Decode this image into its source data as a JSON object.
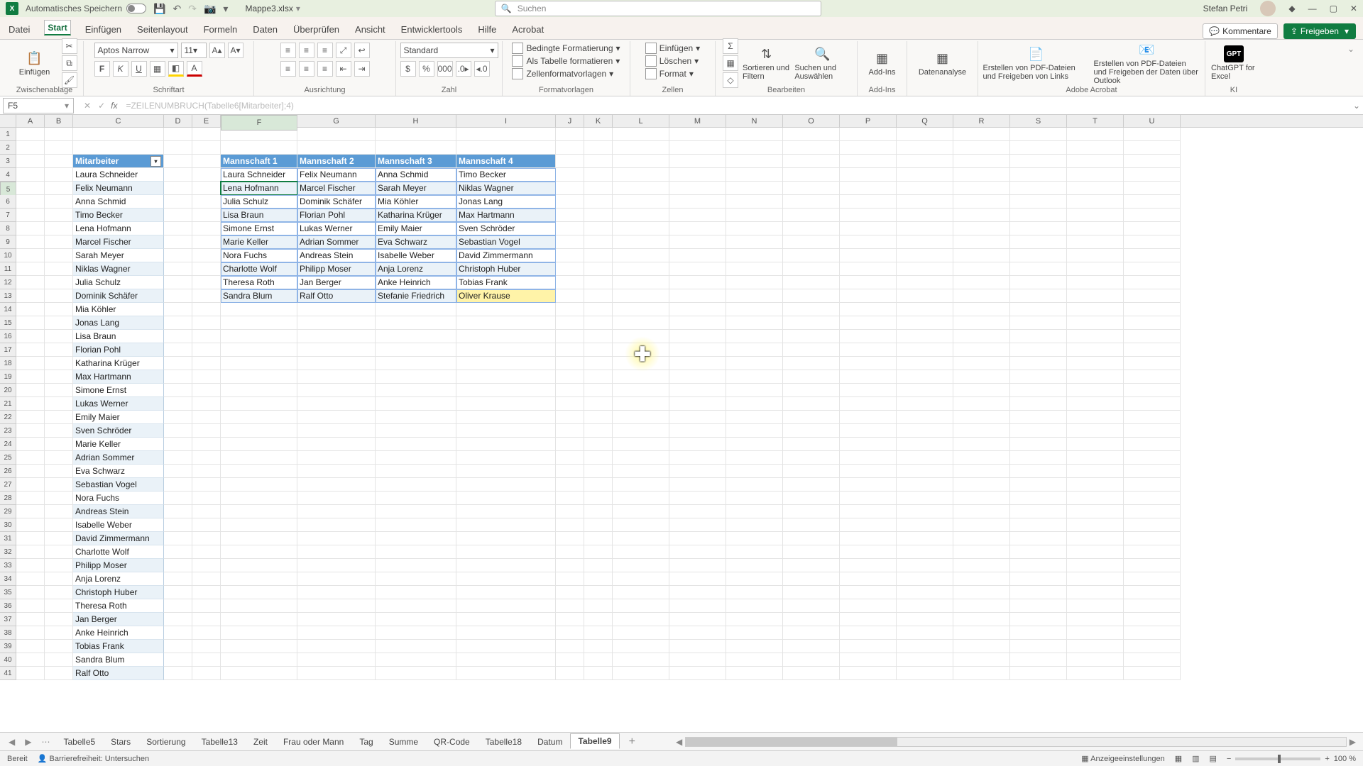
{
  "title": {
    "autosave": "Automatisches Speichern",
    "doc": "Mappe3.xlsx",
    "search": "Suchen",
    "user": "Stefan Petri"
  },
  "menu": [
    "Datei",
    "Start",
    "Einfügen",
    "Seitenlayout",
    "Formeln",
    "Daten",
    "Überprüfen",
    "Ansicht",
    "Entwicklertools",
    "Hilfe",
    "Acrobat"
  ],
  "menu_sel": 1,
  "btns": {
    "comments": "Kommentare",
    "share": "Freigeben"
  },
  "ribbon_groups": {
    "g1": "Zwischenablage",
    "g2": "Schriftart",
    "g3": "Ausrichtung",
    "g4": "Zahl",
    "g5": "Formatvorlagen",
    "g6": "Zellen",
    "g7": "Bearbeiten",
    "g8": "Add-Ins",
    "g9": "",
    "g10": "Adobe Acrobat",
    "g11": "KI"
  },
  "ribbon": {
    "paste": "Einfügen",
    "font": "Aptos Narrow",
    "size": "11",
    "numfmt": "Standard",
    "cond": "Bedingte Formatierung",
    "astab": "Als Tabelle formatieren",
    "cellstyle": "Zellenformatvorlagen",
    "ins": "Einfügen",
    "del": "Löschen",
    "fmt": "Format",
    "sort": "Sortieren und Filtern",
    "find": "Suchen und Auswählen",
    "addins": "Add-Ins",
    "analyze": "Datenanalyse",
    "pdf1": "Erstellen von PDF-Dateien und Freigeben von Links",
    "pdf2": "Erstellen von PDF-Dateien und Freigeben der Daten über Outlook",
    "gpt": "ChatGPT for Excel"
  },
  "namebox": "F5",
  "formula": "=ZEILENUMBRUCH(Tabelle6[Mitarbeiter];4)",
  "cols": {
    "letters": [
      "A",
      "B",
      "C",
      "D",
      "E",
      "F",
      "G",
      "H",
      "I",
      "J",
      "K",
      "L",
      "M",
      "N",
      "O",
      "P",
      "Q",
      "R",
      "S",
      "T",
      "U"
    ],
    "widths": [
      40,
      40,
      128,
      40,
      40,
      108,
      110,
      114,
      140,
      40,
      40,
      80,
      80,
      80,
      80,
      80,
      80,
      80,
      80,
      80,
      80
    ]
  },
  "rowcount": 41,
  "mit_header": "Mitarbeiter",
  "mit": [
    "Laura Schneider",
    "Felix Neumann",
    "Anna Schmid",
    "Timo Becker",
    "Lena Hofmann",
    "Marcel Fischer",
    "Sarah Meyer",
    "Niklas Wagner",
    "Julia Schulz",
    "Dominik Schäfer",
    "Mia Köhler",
    "Jonas Lang",
    "Lisa Braun",
    "Florian Pohl",
    "Katharina Krüger",
    "Max Hartmann",
    "Simone Ernst",
    "Lukas Werner",
    "Emily Maier",
    "Sven Schröder",
    "Marie Keller",
    "Adrian Sommer",
    "Eva Schwarz",
    "Sebastian Vogel",
    "Nora Fuchs",
    "Andreas Stein",
    "Isabelle Weber",
    "David Zimmermann",
    "Charlotte Wolf",
    "Philipp Moser",
    "Anja Lorenz",
    "Christoph Huber",
    "Theresa Roth",
    "Jan Berger",
    "Anke Heinrich",
    "Tobias Frank",
    "Sandra Blum",
    "Ralf Otto"
  ],
  "teams_hdr": [
    "Mannschaft 1",
    "Mannschaft 2",
    "Mannschaft 3",
    "Mannschaft 4"
  ],
  "teams": [
    [
      "Laura Schneider",
      "Felix Neumann",
      "Anna Schmid",
      "Timo Becker"
    ],
    [
      "Lena Hofmann",
      "Marcel Fischer",
      "Sarah Meyer",
      "Niklas Wagner"
    ],
    [
      "Julia Schulz",
      "Dominik Schäfer",
      "Mia Köhler",
      "Jonas Lang"
    ],
    [
      "Lisa Braun",
      "Florian Pohl",
      "Katharina Krüger",
      "Max Hartmann"
    ],
    [
      "Simone Ernst",
      "Lukas Werner",
      "Emily Maier",
      "Sven Schröder"
    ],
    [
      "Marie Keller",
      "Adrian Sommer",
      "Eva Schwarz",
      "Sebastian Vogel"
    ],
    [
      "Nora Fuchs",
      "Andreas Stein",
      "Isabelle Weber",
      "David Zimmermann"
    ],
    [
      "Charlotte Wolf",
      "Philipp Moser",
      "Anja Lorenz",
      "Christoph Huber"
    ],
    [
      "Theresa Roth",
      "Jan Berger",
      "Anke Heinrich",
      "Tobias Frank"
    ],
    [
      "Sandra Blum",
      "Ralf Otto",
      "Stefanie Friedrich",
      "Oliver Krause"
    ]
  ],
  "sheets": [
    "Tabelle5",
    "Stars",
    "Sortierung",
    "Tabelle13",
    "Zeit",
    "Frau oder Mann",
    "Tag",
    "Summe",
    "QR-Code",
    "Tabelle18",
    "Datum",
    "Tabelle9"
  ],
  "sheet_sel": 11,
  "status": {
    "ready": "Bereit",
    "acc": "Barrierefreiheit: Untersuchen",
    "disp": "Anzeigeeinstellungen",
    "zoom": "100 %"
  }
}
